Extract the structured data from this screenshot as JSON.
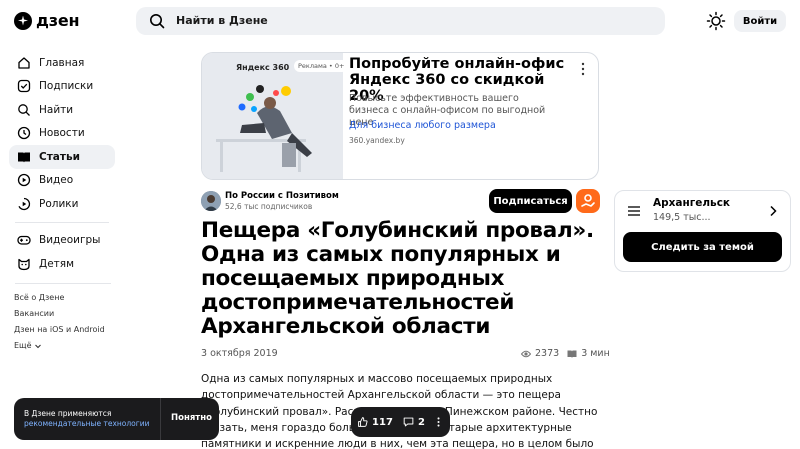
{
  "header": {
    "logo_text": "дзен",
    "search_placeholder": "Найти в Дзене",
    "login_label": "Войти"
  },
  "sidebar": {
    "items": [
      {
        "label": "Главная",
        "icon": "home-icon"
      },
      {
        "label": "Подписки",
        "icon": "subscriptions-icon"
      },
      {
        "label": "Найти",
        "icon": "search-icon"
      },
      {
        "label": "Новости",
        "icon": "news-icon"
      },
      {
        "label": "Статьи",
        "icon": "articles-icon",
        "active": true
      },
      {
        "label": "Видео",
        "icon": "video-icon"
      },
      {
        "label": "Ролики",
        "icon": "shorts-icon"
      }
    ],
    "extra_items": [
      {
        "label": "Видеоигры",
        "icon": "gamepad-icon"
      },
      {
        "label": "Детям",
        "icon": "kids-icon"
      }
    ],
    "footer_links": [
      "Всё о Дзене",
      "Вакансии",
      "Дзен на iOS и Android",
      "Ещё"
    ]
  },
  "ad": {
    "brand": "Яндекс 360",
    "badge": "Реклама • 0+",
    "title": "Попробуйте онлайн-офис Яндекс 360 со скидкой 20%",
    "description": "Повысьте эффективность вашего бизнеса с онлайн-офисом по выгодной цене",
    "link": "Для бизнеса любого размера",
    "domain": "360.yandex.by"
  },
  "channel": {
    "name": "По России с Позитивом",
    "subscribers": "52,6 тыс подписчиков",
    "subscribe_label": "Подписаться"
  },
  "article": {
    "title": "Пещера «Голубинский провал». Одна из самых популярных и посещаемых природных достопримечательностей Архангельской области",
    "date": "3 октября 2019",
    "views": "2373",
    "read_time": "3 мин",
    "body": "Одна из самых популярных и массово посещаемых природных достопримечательностей Архангельской области — это пещера «Голубинский провал». Расположена она в Пинежском районе. Честно сказать, меня гораздо больше впечатлили старые архитектурные памятники и искренние люди в них, чем эта пещера, но в целом было интересно. Забегая вперёд отмечу, что"
  },
  "topic": {
    "name": "Архангельск",
    "count": "149,5 тыс...",
    "follow_label": "Следить за темой"
  },
  "cookie": {
    "text": "В Дзене применяются",
    "link": "рекомендательные технологии",
    "button": "Понятно"
  },
  "reactions": {
    "likes": "117",
    "comments": "2"
  },
  "colors": {
    "accent_orange": "#ff6a1a",
    "link_blue": "#1f55d6",
    "dark_bar": "#1b1b1d"
  }
}
